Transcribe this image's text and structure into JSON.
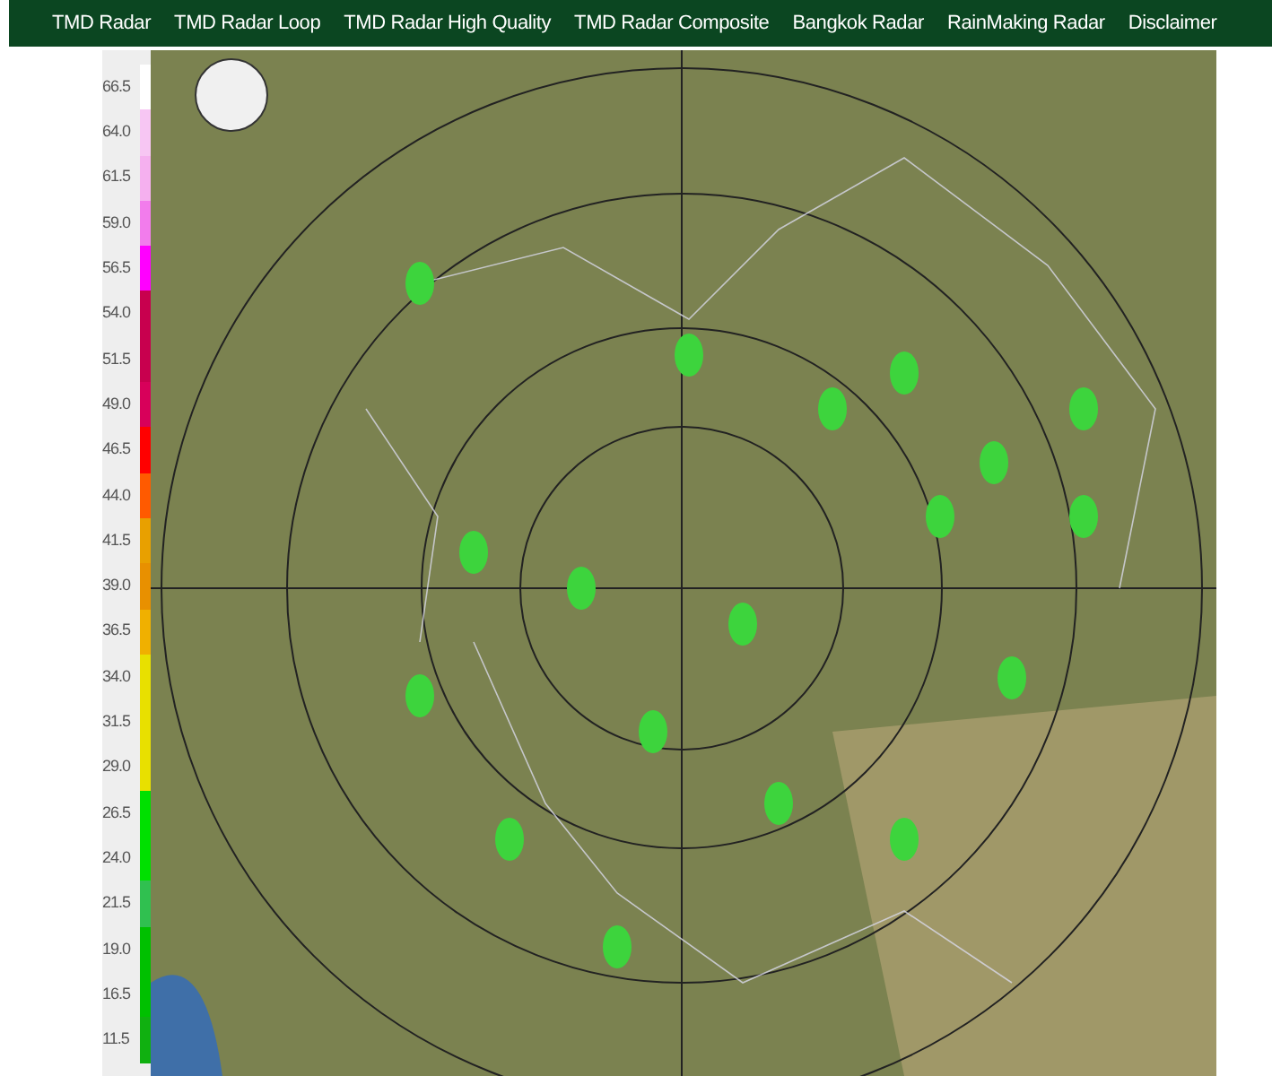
{
  "nav": [
    {
      "label": "TMD Radar"
    },
    {
      "label": "TMD Radar Loop"
    },
    {
      "label": "TMD Radar High Quality"
    },
    {
      "label": "TMD Radar Composite"
    },
    {
      "label": "Bangkok Radar"
    },
    {
      "label": "RainMaking Radar"
    },
    {
      "label": "Disclaimer"
    }
  ],
  "legend": [
    {
      "label": "66.5",
      "color": "#ffffff"
    },
    {
      "label": "64.0",
      "color": "#f7c6f3"
    },
    {
      "label": "61.5",
      "color": "#f5b0ef"
    },
    {
      "label": "59.0",
      "color": "#f27cec"
    },
    {
      "label": "56.5",
      "color": "#ff00ff"
    },
    {
      "label": "54.0",
      "color": "#c8004e"
    },
    {
      "label": "51.5",
      "color": "#c8004e"
    },
    {
      "label": "49.0",
      "color": "#d8005a"
    },
    {
      "label": "46.5",
      "color": "#ff0000"
    },
    {
      "label": "44.0",
      "color": "#ff5a00"
    },
    {
      "label": "41.5",
      "color": "#e8a000"
    },
    {
      "label": "39.0",
      "color": "#e89000"
    },
    {
      "label": "36.5",
      "color": "#f0b000"
    },
    {
      "label": "34.0",
      "color": "#e8e000"
    },
    {
      "label": "31.5",
      "color": "#e8e000"
    },
    {
      "label": "29.0",
      "color": "#e8e000"
    },
    {
      "label": "26.5",
      "color": "#00e000"
    },
    {
      "label": "24.0",
      "color": "#00e000"
    },
    {
      "label": "21.5",
      "color": "#30c050"
    },
    {
      "label": "19.0",
      "color": "#00c000"
    },
    {
      "label": "16.5",
      "color": "#00c000"
    },
    {
      "label": "11.5",
      "color": "#10b010"
    }
  ]
}
